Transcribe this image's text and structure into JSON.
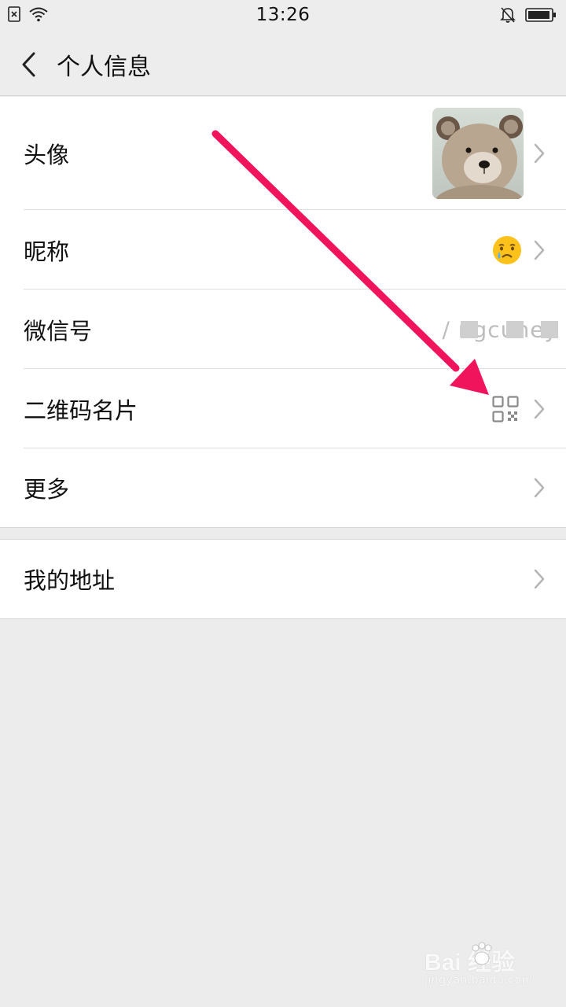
{
  "status_bar": {
    "time": "13:26",
    "icons": [
      "sim-absent-icon",
      "wifi-icon",
      "bell-muted-icon",
      "battery-icon"
    ]
  },
  "header": {
    "title": "个人信息",
    "back_icon": "chevron-left-icon"
  },
  "profile": {
    "avatar": {
      "label": "头像",
      "image": "teddy-bear-avatar"
    },
    "nickname": {
      "label": "昵称",
      "value_icon": "crying-face-emoji"
    },
    "wechat_id": {
      "label": "微信号",
      "value": "/ ngcuney"
    },
    "qr_code": {
      "label": "二维码名片",
      "value_icon": "qr-code-icon"
    },
    "more": {
      "label": "更多"
    }
  },
  "address": {
    "label": "我的地址"
  },
  "watermark": {
    "logo": "Bai  经验",
    "url": "jingyan.baidu.com"
  },
  "colors": {
    "background": "#ececec",
    "card": "#ffffff",
    "annotation_arrow": "#f0145d",
    "chevron": "#b5b5b5"
  }
}
